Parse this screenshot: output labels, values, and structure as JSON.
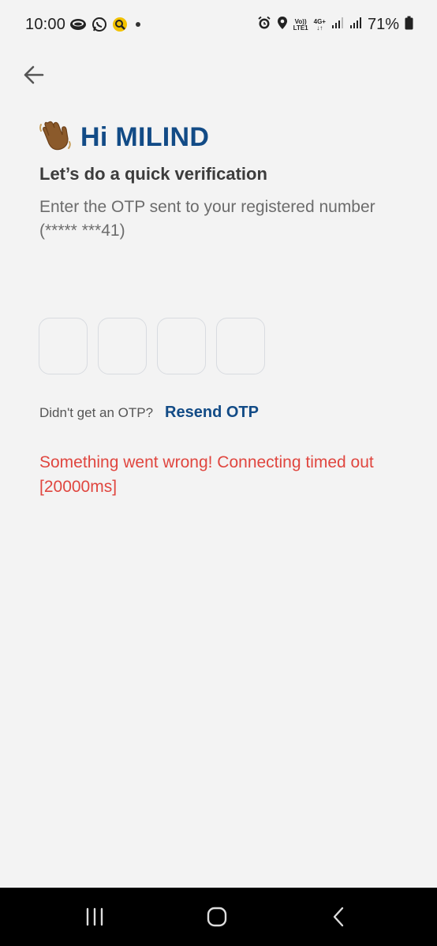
{
  "status_bar": {
    "time": "10:00",
    "network_volte": "Vo))",
    "network_lte": "LTE1",
    "network_4g": "4G+",
    "battery_percent": "71%",
    "icons": [
      "chat-bubble-icon",
      "whatsapp-icon",
      "search-app-icon",
      "notification-dot-icon",
      "alarm-icon",
      "location-icon",
      "signal-icon",
      "signal-icon",
      "battery-icon"
    ]
  },
  "header": {
    "back_icon": "arrow-left-icon"
  },
  "greeting": {
    "emoji": "👋🏾",
    "title": "Hi MILIND"
  },
  "verification": {
    "subtitle": "Let’s do a quick verification",
    "instruction": "Enter the OTP sent to your registered number (*****  ***41)"
  },
  "otp": {
    "digits": [
      "",
      "",
      "",
      ""
    ]
  },
  "resend": {
    "prompt": "Didn't get an OTP?",
    "link_label": "Resend OTP"
  },
  "error": {
    "message": "Something went wrong! Connecting timed out [20000ms]"
  },
  "colors": {
    "background": "#f3f3f3",
    "brand_blue": "#124b86",
    "error_red": "#e0463f",
    "muted_text": "#6c6c6c",
    "box_border": "#d8dbe0"
  },
  "nav_bar": {
    "icons": [
      "recent-apps-icon",
      "home-icon",
      "back-icon"
    ]
  }
}
